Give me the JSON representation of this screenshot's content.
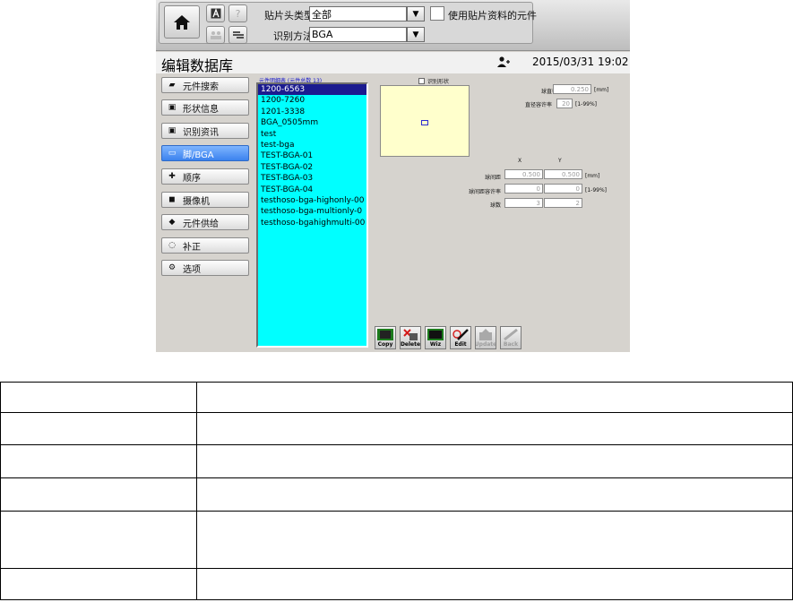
{
  "toolbar": {
    "nozzle_type_label": "贴片头类型",
    "nozzle_type_value": "全部",
    "recognition_label": "识别方法",
    "recognition_value": "BGA",
    "use_part_data_label": "使用贴片资料的元件",
    "help_glyph": "?",
    "icons": [
      "home-icon",
      "a-icon",
      "help-icon",
      "user-group-icon",
      "tool-icon"
    ]
  },
  "header": {
    "title": "编辑数据库",
    "datetime": "2015/03/31 19:02"
  },
  "menu": {
    "items": [
      {
        "label": "元件搜索",
        "icon": "search-icon"
      },
      {
        "label": "形状信息",
        "icon": "shape-icon"
      },
      {
        "label": "识别资讯",
        "icon": "recognition-icon"
      },
      {
        "label": "脚/BGA",
        "icon": "bga-icon",
        "active": true
      },
      {
        "label": "顺序",
        "icon": "order-icon"
      },
      {
        "label": "摄像机",
        "icon": "camera-icon"
      },
      {
        "label": "元件供给",
        "icon": "feeder-icon"
      },
      {
        "label": "补正",
        "icon": "correction-icon"
      },
      {
        "label": "选项",
        "icon": "options-icon"
      }
    ]
  },
  "parts_list": {
    "caption": "元件明细表 (元件总数 13)",
    "items": [
      "1200-6563",
      "1200-7260",
      "1201-3338",
      "BGA_0505mm",
      "test",
      "test-bga",
      "TEST-BGA-01",
      "TEST-BGA-02",
      "TEST-BGA-03",
      "TEST-BGA-04",
      "testhoso-bga-highonly-00",
      "testhoso-bga-multionly-0",
      "testhoso-bgahighmulti-00"
    ],
    "selected_index": 0
  },
  "preview": {
    "shape_check_label": "识别形状"
  },
  "params": {
    "ball_diameter_label": "球直径",
    "ball_diameter_value": "0.250",
    "ball_diameter_unit": "[mm]",
    "diameter_tolerance_label": "直径容许率",
    "diameter_tolerance_value": "20",
    "diameter_tolerance_unit": "[1-99%]",
    "col_x": "X",
    "col_y": "Y",
    "pitch_label": "球间距",
    "pitch_x": "0.500",
    "pitch_y": "0.500",
    "pitch_unit": "[mm]",
    "pitch_tolerance_label": "球间距容许率",
    "pitch_tolerance_x": "0",
    "pitch_tolerance_y": "0",
    "pitch_tolerance_unit": "[1-99%]",
    "count_label": "球数",
    "count_x": "3",
    "count_y": "2"
  },
  "actions": [
    {
      "label": "Copy",
      "enabled": true
    },
    {
      "label": "Delete",
      "enabled": true
    },
    {
      "label": "Wiz",
      "enabled": true
    },
    {
      "label": "Edit",
      "enabled": true
    },
    {
      "label": "Update",
      "enabled": false
    },
    {
      "label": "Back",
      "enabled": false
    }
  ],
  "colors": {
    "list_bg": "#00ffff",
    "list_selected": "#1b1b8f",
    "menu_active": "#3b82ee",
    "preview_bg": "#ffffcc",
    "caption_text": "#1313c9"
  }
}
